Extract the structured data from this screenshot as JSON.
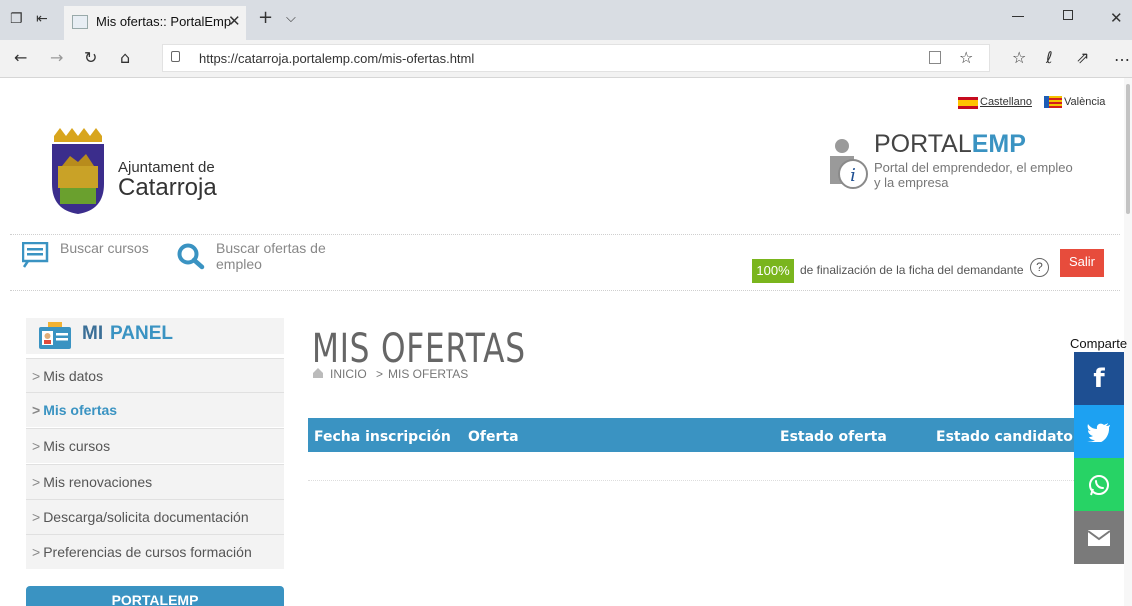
{
  "browser": {
    "tab_title": "Mis ofertas:: PortalEmp",
    "new_tab_symbol": "+",
    "url": "https://catarroja.portalemp.com/mis-ofertas.html"
  },
  "header": {
    "lang_es": "Castellano",
    "lang_va": "València",
    "ayto_line1": "Ajuntament de",
    "ayto_line2": "Catarroja",
    "portal_name_a": "PORTAL",
    "portal_name_b": "EMP",
    "portal_tagline1": "Portal del emprendedor, el empleo",
    "portal_tagline2": "y la empresa"
  },
  "nav": {
    "buscar_cursos": "Buscar cursos",
    "buscar_ofertas_1": "Buscar ofertas de",
    "buscar_ofertas_2": "empleo",
    "progress": "100%",
    "progress_text": "de finalización de la ficha del demandante",
    "help_symbol": "?",
    "salir": "Salir"
  },
  "sidebar": {
    "title_a": "MI",
    "title_b": "PANEL",
    "items": [
      {
        "label": "Mis datos"
      },
      {
        "label": "Mis ofertas"
      },
      {
        "label": "Mis cursos"
      },
      {
        "label": "Mis renovaciones"
      },
      {
        "label": "Descarga/solicita documentación"
      },
      {
        "label": "Preferencias de cursos formación"
      }
    ],
    "chevron": ">",
    "bottom_box": "PORTALEMP"
  },
  "main": {
    "title": "MIS OFERTAS",
    "breadcrumb_home": "INICIO",
    "breadcrumb_sep": ">",
    "breadcrumb_current": "MIS OFERTAS",
    "columns": [
      "Fecha inscripción",
      "Oferta",
      "Estado oferta",
      "Estado candidato"
    ]
  },
  "share": {
    "label": "Comparte"
  },
  "colors": {
    "table_header": "#3a93c2",
    "salir": "#e74c3c",
    "progress": "#7ab51d",
    "facebook": "#1e4f92",
    "twitter": "#1da1f2",
    "whatsapp": "#27d365",
    "email": "#7a7a7a"
  }
}
